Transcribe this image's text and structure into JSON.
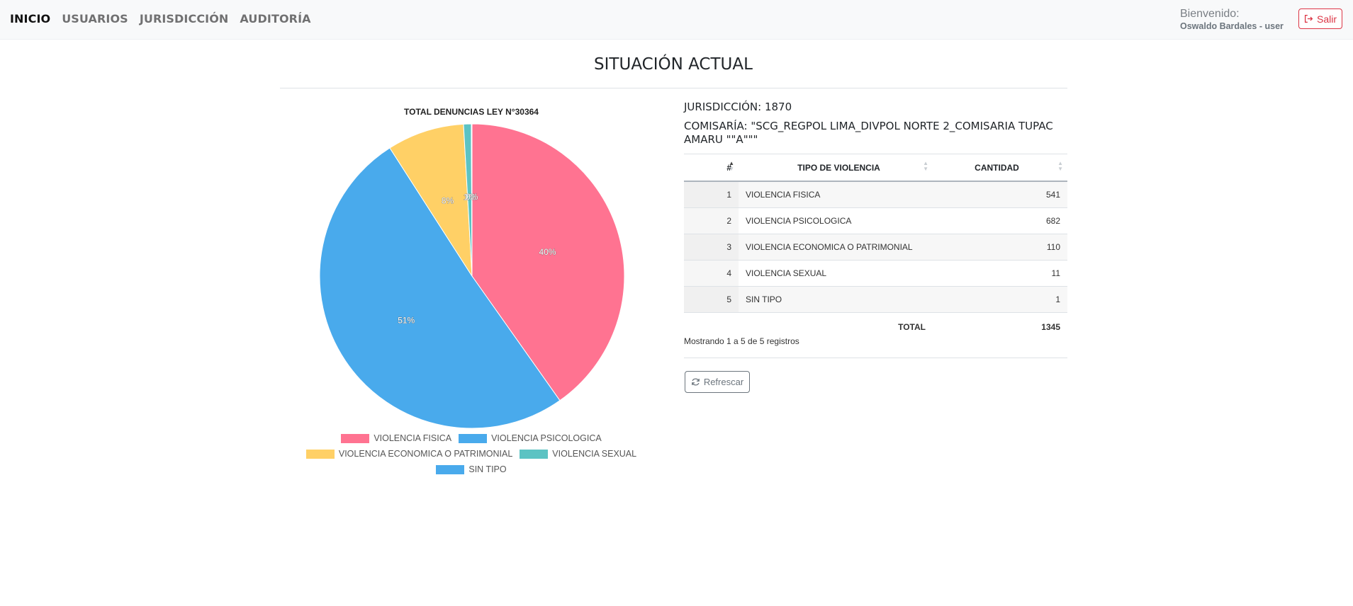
{
  "nav": {
    "links": [
      "INICIO",
      "USUARIOS",
      "JURISDICCIÓN",
      "AUDITORÍA"
    ],
    "active": "INICIO",
    "welcome_label": "Bienvenido:",
    "user": "Oswaldo Bardales - user",
    "logout_label": "Salir"
  },
  "page": {
    "title": "SITUACIÓN ACTUAL"
  },
  "info": {
    "jurisdiccion": "JURISDICCIÓN: 1870",
    "comisaria": "COMISARÍA: \"SCG_REGPOL LIMA_DIVPOL NORTE 2_COMISARIA TUPAC AMARU \"\"A\"\"\""
  },
  "table": {
    "headers": {
      "num": "#",
      "tipo": "TIPO DE VIOLENCIA",
      "cantidad": "CANTIDAD"
    },
    "rows": [
      {
        "num": "1",
        "tipo": "VIOLENCIA FISICA",
        "cantidad": "541"
      },
      {
        "num": "2",
        "tipo": "VIOLENCIA PSICOLOGICA",
        "cantidad": "682"
      },
      {
        "num": "3",
        "tipo": "VIOLENCIA ECONOMICA O PATRIMONIAL",
        "cantidad": "110"
      },
      {
        "num": "4",
        "tipo": "VIOLENCIA SEXUAL",
        "cantidad": "11"
      },
      {
        "num": "5",
        "tipo": "SIN TIPO",
        "cantidad": "1"
      }
    ],
    "total_label": "TOTAL",
    "total_value": "1345",
    "info_text": "Mostrando 1 a 5 de 5 registros",
    "refresh_label": "Refrescar"
  },
  "colors": {
    "fisica": "#ff7391",
    "psicologica": "#49aaec",
    "economica": "#ffd066",
    "sexual": "#5cc3c3",
    "sin_tipo": "#49aaec"
  },
  "chart_data": {
    "type": "pie",
    "title": "TOTAL DENUNCIAS LEY N°30364",
    "categories": [
      "VIOLENCIA FISICA",
      "VIOLENCIA PSICOLOGICA",
      "VIOLENCIA ECONOMICA O PATRIMONIAL",
      "VIOLENCIA SEXUAL",
      "SIN TIPO"
    ],
    "values": [
      541,
      682,
      110,
      11,
      1
    ],
    "labels": [
      "40%",
      "51%",
      "8%",
      "1%",
      "0%"
    ],
    "legend": "bottom"
  }
}
